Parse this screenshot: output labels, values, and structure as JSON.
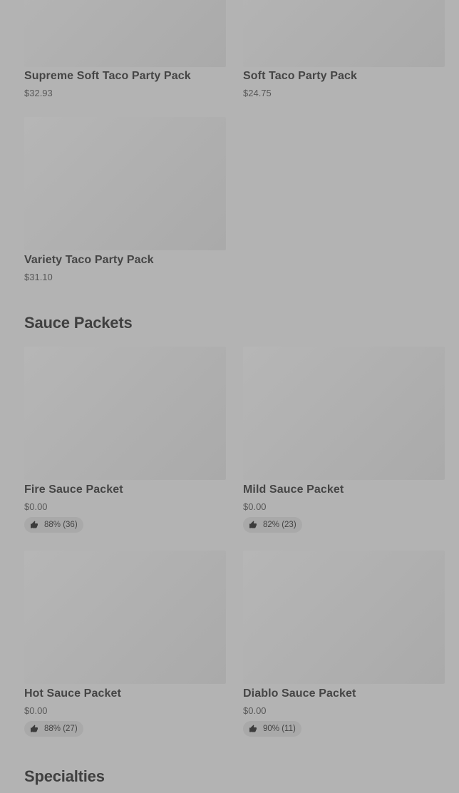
{
  "party_packs": {
    "items": [
      {
        "name": "Supreme Soft Taco Party Pack",
        "price": "$32.93"
      },
      {
        "name": "Soft Taco Party Pack",
        "price": "$24.75"
      },
      {
        "name": "Variety Taco Party Pack",
        "price": "$31.10"
      }
    ]
  },
  "sauce_packets": {
    "title": "Sauce Packets",
    "items": [
      {
        "name": "Fire Sauce Packet",
        "price": "$0.00",
        "rating": "88% (36)",
        "rating_icon": "thumbs-up-icon"
      },
      {
        "name": "Mild Sauce Packet",
        "price": "$0.00",
        "rating": "82% (23)",
        "rating_icon": "thumbs-up-icon"
      },
      {
        "name": "Hot Sauce Packet",
        "price": "$0.00",
        "rating": "88% (27)",
        "rating_icon": "thumbs-up-icon"
      },
      {
        "name": "Diablo Sauce Packet",
        "price": "$0.00",
        "rating": "90% (11)",
        "rating_icon": "thumbs-up-icon"
      }
    ]
  },
  "specialties": {
    "title": "Specialties"
  },
  "colors": {
    "overlay_background": "#b3b3b3",
    "thumbnail": "#afafaf",
    "rating_pill": "#a9a9a9",
    "text_dark": "#454545"
  }
}
